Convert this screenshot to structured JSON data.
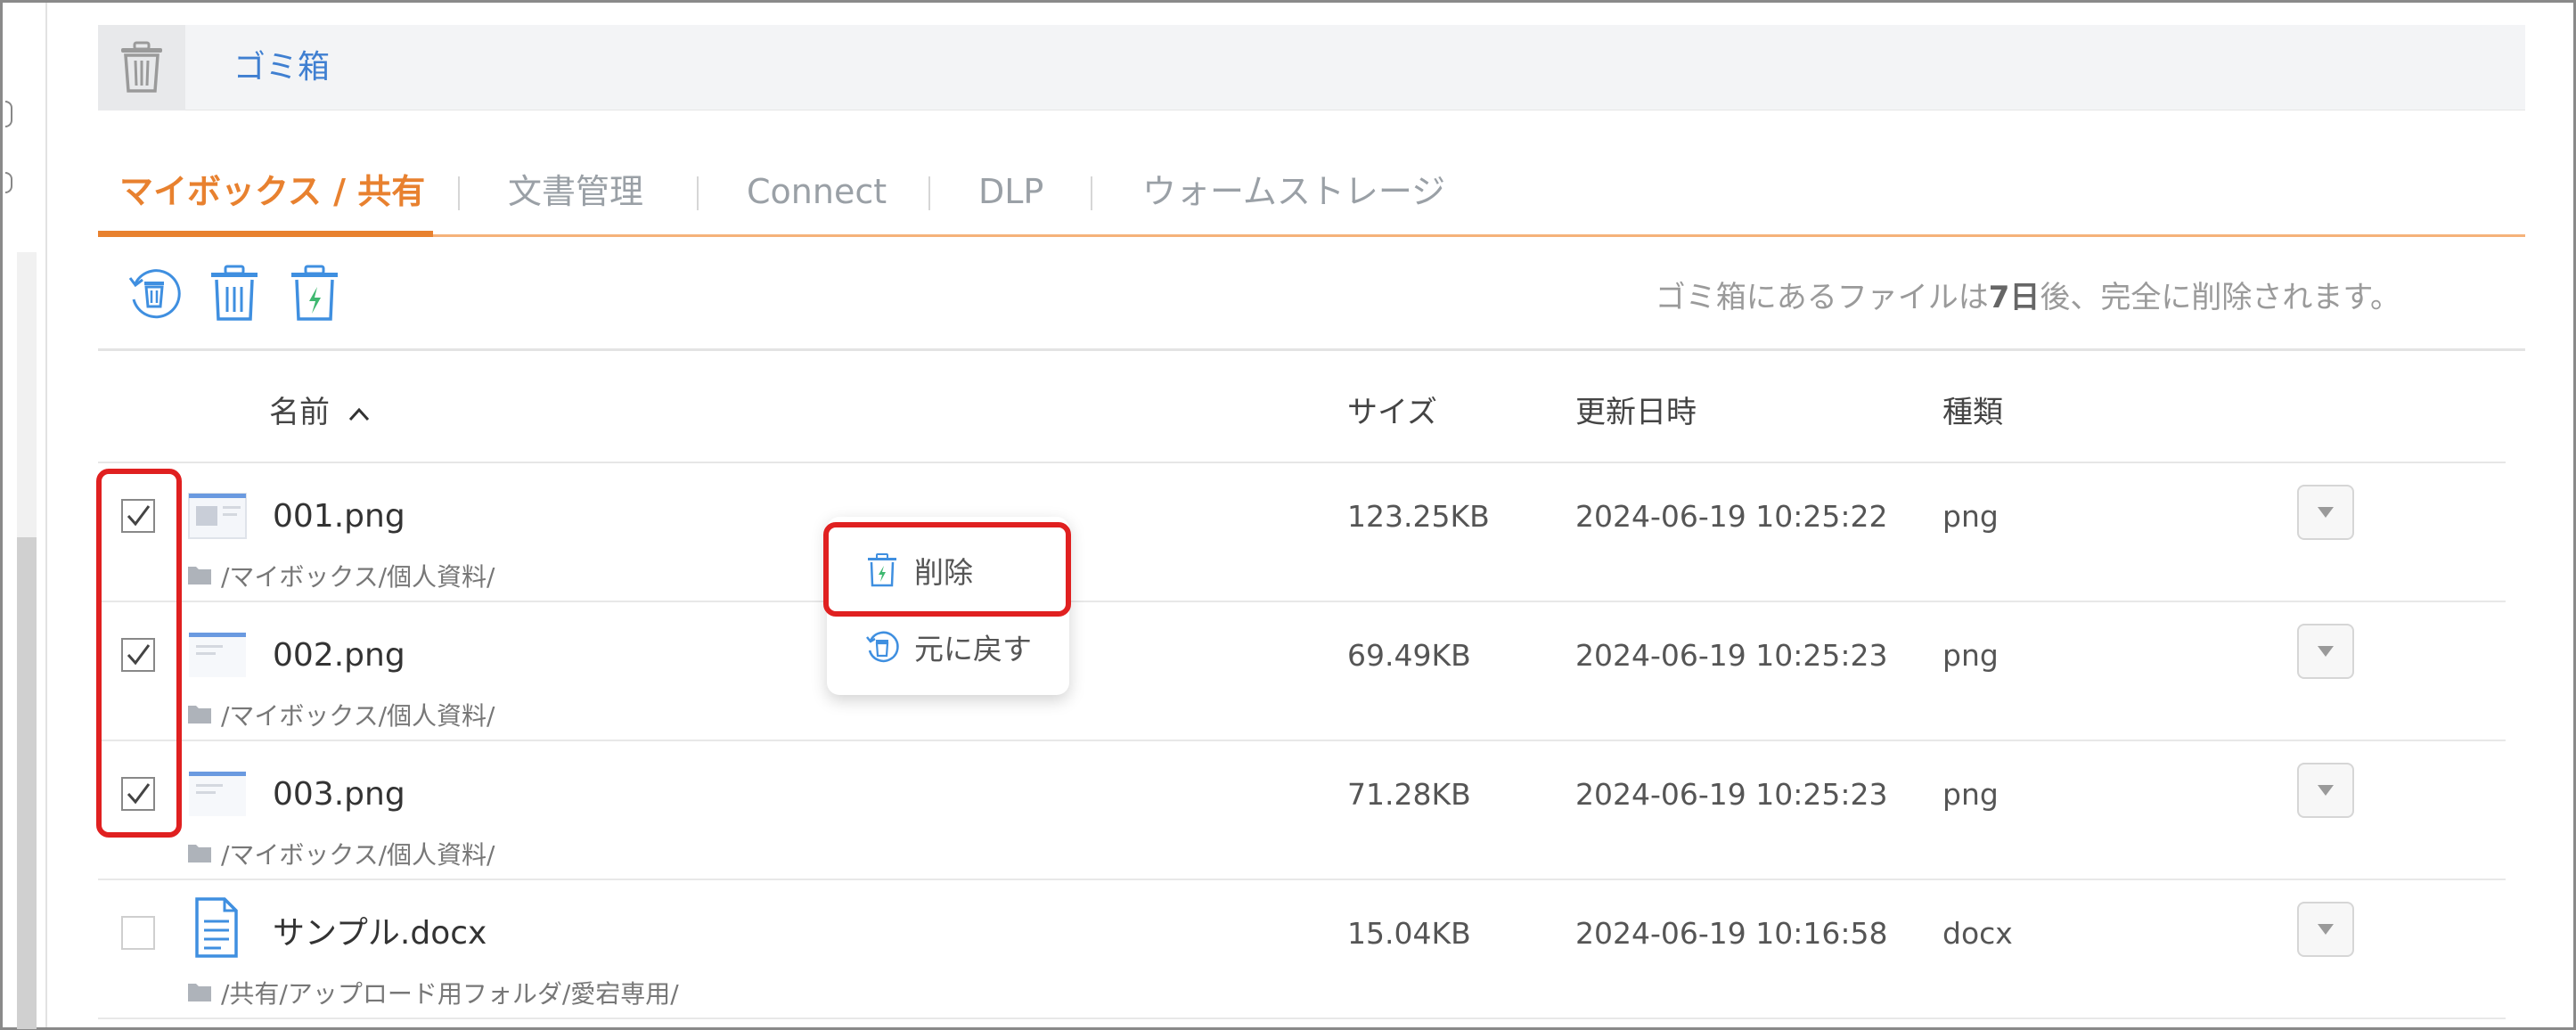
{
  "header": {
    "title": "ゴミ箱",
    "icon": "trash-icon"
  },
  "tabs": [
    {
      "label": "マイボックス / 共有",
      "active": true
    },
    {
      "label": "文書管理",
      "active": false
    },
    {
      "label": "Connect",
      "active": false
    },
    {
      "label": "DLP",
      "active": false
    },
    {
      "label": "ウォームストレージ",
      "active": false
    }
  ],
  "toolbar": {
    "buttons": [
      "restore-trash-icon",
      "delete-trash-icon",
      "force-delete-trash-icon"
    ],
    "notice_prefix": "ゴミ箱にあるファイルは",
    "notice_bold": "7日",
    "notice_suffix": "後、完全に削除されます。"
  },
  "columns": {
    "name": "名前",
    "size": "サイズ",
    "updated": "更新日時",
    "type": "種類"
  },
  "files": [
    {
      "name": "001.png",
      "path": "/マイボックス/個人資料/",
      "size": "123.25KB",
      "updated": "2024-06-19 10:25:22",
      "type": "png",
      "checked": true,
      "icon": "image-thumbnail-icon"
    },
    {
      "name": "002.png",
      "path": "/マイボックス/個人資料/",
      "size": "69.49KB",
      "updated": "2024-06-19 10:25:23",
      "type": "png",
      "checked": true,
      "icon": "image-thumbnail-icon"
    },
    {
      "name": "003.png",
      "path": "/マイボックス/個人資料/",
      "size": "71.28KB",
      "updated": "2024-06-19 10:25:23",
      "type": "png",
      "checked": true,
      "icon": "image-thumbnail-icon"
    },
    {
      "name": "サンプル.docx",
      "path": "/共有/アップロード用フォルダ/愛宕専用/",
      "size": "15.04KB",
      "updated": "2024-06-19 10:16:58",
      "type": "docx",
      "checked": false,
      "icon": "document-icon"
    }
  ],
  "context_menu": {
    "delete": "削除",
    "restore": "元に戻す"
  },
  "colors": {
    "accent": "#e8812f",
    "link": "#3f7fd1",
    "highlight": "#e02020"
  }
}
